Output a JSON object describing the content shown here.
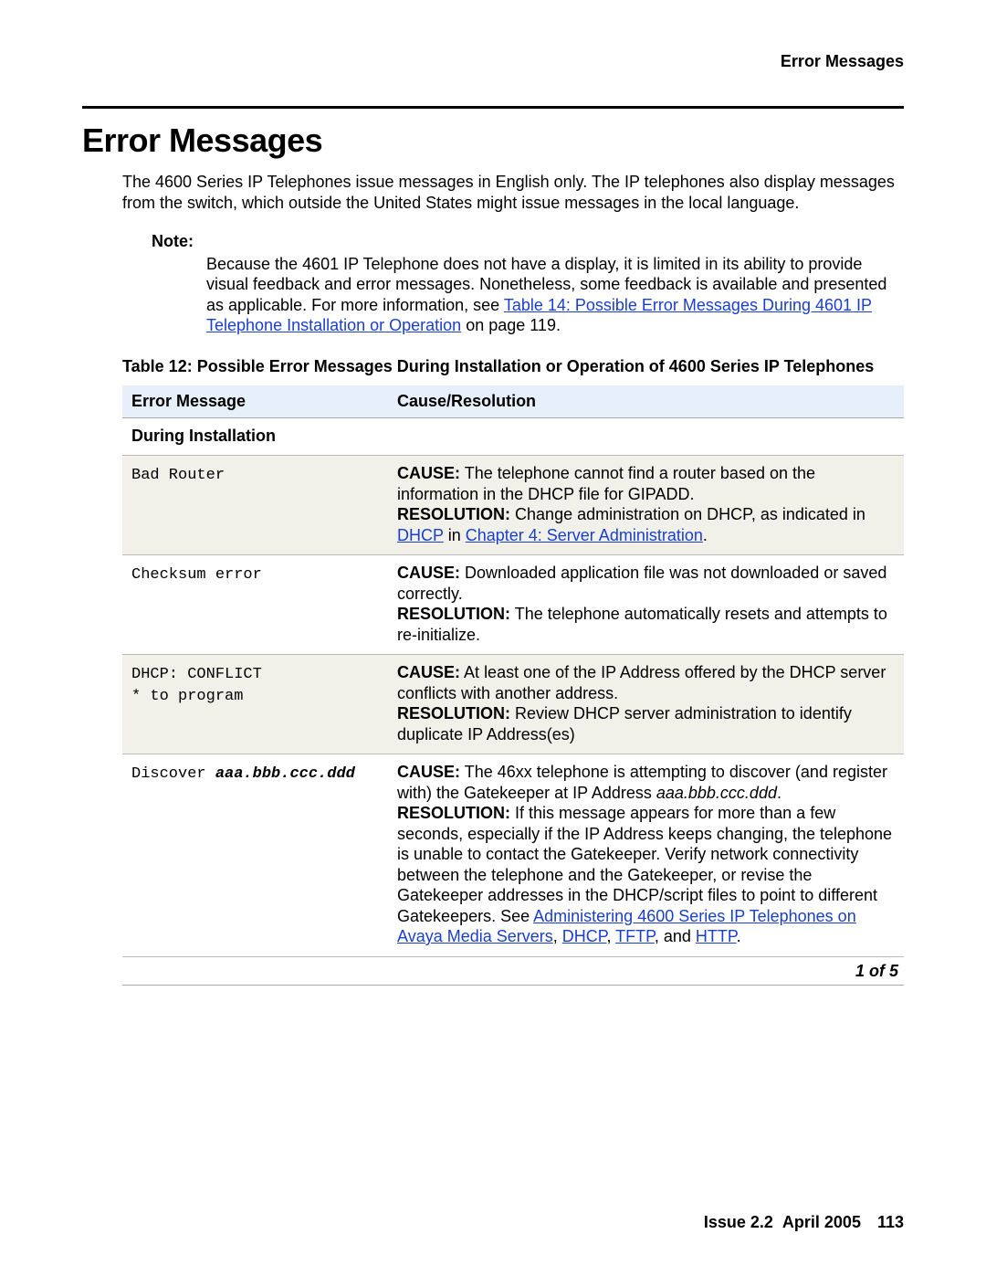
{
  "header": {
    "running_head": "Error Messages"
  },
  "title": "Error Messages",
  "intro": "The 4600 Series IP Telephones issue messages in English only. The IP telephones also display messages from the switch, which outside the United States might issue messages in the local language.",
  "note": {
    "label": "Note:",
    "body_pre": "Because the 4601 IP Telephone does not have a display, it is limited in its ability to provide visual feedback and error messages. Nonetheless, some feedback is available and presented as applicable. For more information, see ",
    "link": "Table 14:  Possible Error Messages During 4601 IP Telephone Installation or Operation",
    "body_post": " on page 119."
  },
  "table": {
    "caption": "Table 12: Possible Error Messages During Installation or Operation of 4600 Series IP Telephones",
    "headers": {
      "c1": "Error Message",
      "c2": "Cause/Resolution"
    },
    "section1": "During Installation",
    "rows": [
      {
        "msg": "Bad Router",
        "cause_label": "CAUSE:",
        "cause": " The telephone cannot find a router based on the information in the DHCP file for GIPADD.",
        "res_label": "RESOLUTION:",
        "res_pre": " Change administration on DHCP, as indicated in ",
        "link1": "DHCP",
        "mid": " in ",
        "link2": "Chapter 4: Server Administration",
        "res_post": "."
      },
      {
        "msg": "Checksum error",
        "cause_label": "CAUSE:",
        "cause": " Downloaded application file was not downloaded or saved correctly.",
        "res_label": "RESOLUTION:",
        "res": " The telephone automatically resets and attempts to re-initialize."
      },
      {
        "msg": "DHCP: CONFLICT\n* to program",
        "cause_label": "CAUSE:",
        "cause": " At least one of the IP Address offered by the DHCP server conflicts with another address.",
        "res_label": "RESOLUTION:",
        "res": " Review DHCP server administration to identify duplicate IP Address(es)"
      },
      {
        "msg_pre": "Discover ",
        "msg_bi": "aaa.bbb.ccc.ddd",
        "cause_label": "CAUSE:",
        "cause_pre": " The 46xx telephone is attempting to discover (and register with) the Gatekeeper at IP Address ",
        "cause_ital": "aaa.bbb.ccc.ddd",
        "cause_post": ".",
        "res_label": "RESOLUTION:",
        "res_pre": " If this message appears for more than a few seconds, especially if the IP Address keeps changing, the telephone is unable to contact the Gatekeeper. Verify network connectivity between the telephone and the Gatekeeper, or revise the Gatekeeper addresses in the DHCP/script files to point to different Gatekeepers. See ",
        "link1": "Administering 4600 Series IP Telephones on Avaya Media Servers",
        "sep1": ", ",
        "link2": "DHCP",
        "sep2": ", ",
        "link3": "TFTP",
        "sep3": ", and ",
        "link4": "HTTP",
        "res_post": "."
      }
    ],
    "page_of": "1 of 5"
  },
  "footer": {
    "issue": "Issue 2.2",
    "date": "April 2005",
    "page": "113"
  }
}
